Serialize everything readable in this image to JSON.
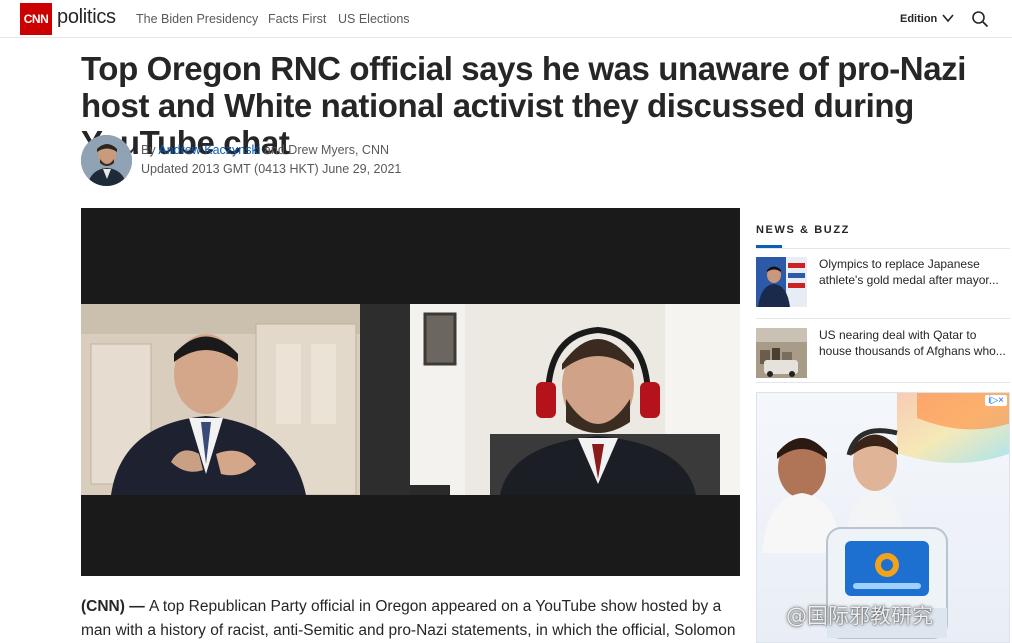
{
  "header": {
    "logo_text": "CNN",
    "section": "politics",
    "nav": [
      "The Biden Presidency",
      "Facts First",
      "US Elections"
    ],
    "edition_label": "Edition",
    "edition_icon": "chevron-down-icon",
    "search_icon": "search-icon",
    "brand_color": "#cc0000"
  },
  "article": {
    "headline": "Top Oregon RNC official says he was unaware of pro-Nazi host and White national activist they discussed during YouTube chat",
    "byline_prefix": "By ",
    "author1": "Andrew Kaczynski",
    "byline_rest": " and Drew Myers, CNN",
    "updated": "Updated 2013 GMT (0413 HKT) June 29, 2021",
    "dateline": "(CNN) — ",
    "body": "A top Republican Party official in Oregon appeared on a YouTube show hosted by a man with a history of racist, anti-Semitic and pro-Nazi statements, in which the official, Solomon Yue,",
    "link_color": "#0c5db7"
  },
  "sidebar": {
    "title": "NEWS & BUZZ",
    "items": [
      {
        "text": "Olympics to replace Japanese athlete's gold medal after mayor..."
      },
      {
        "text": "US nearing deal with Qatar to house thousands of Afghans who..."
      }
    ]
  },
  "ad": {
    "badge": "i▷×"
  },
  "watermark": "@国际邪教研究"
}
